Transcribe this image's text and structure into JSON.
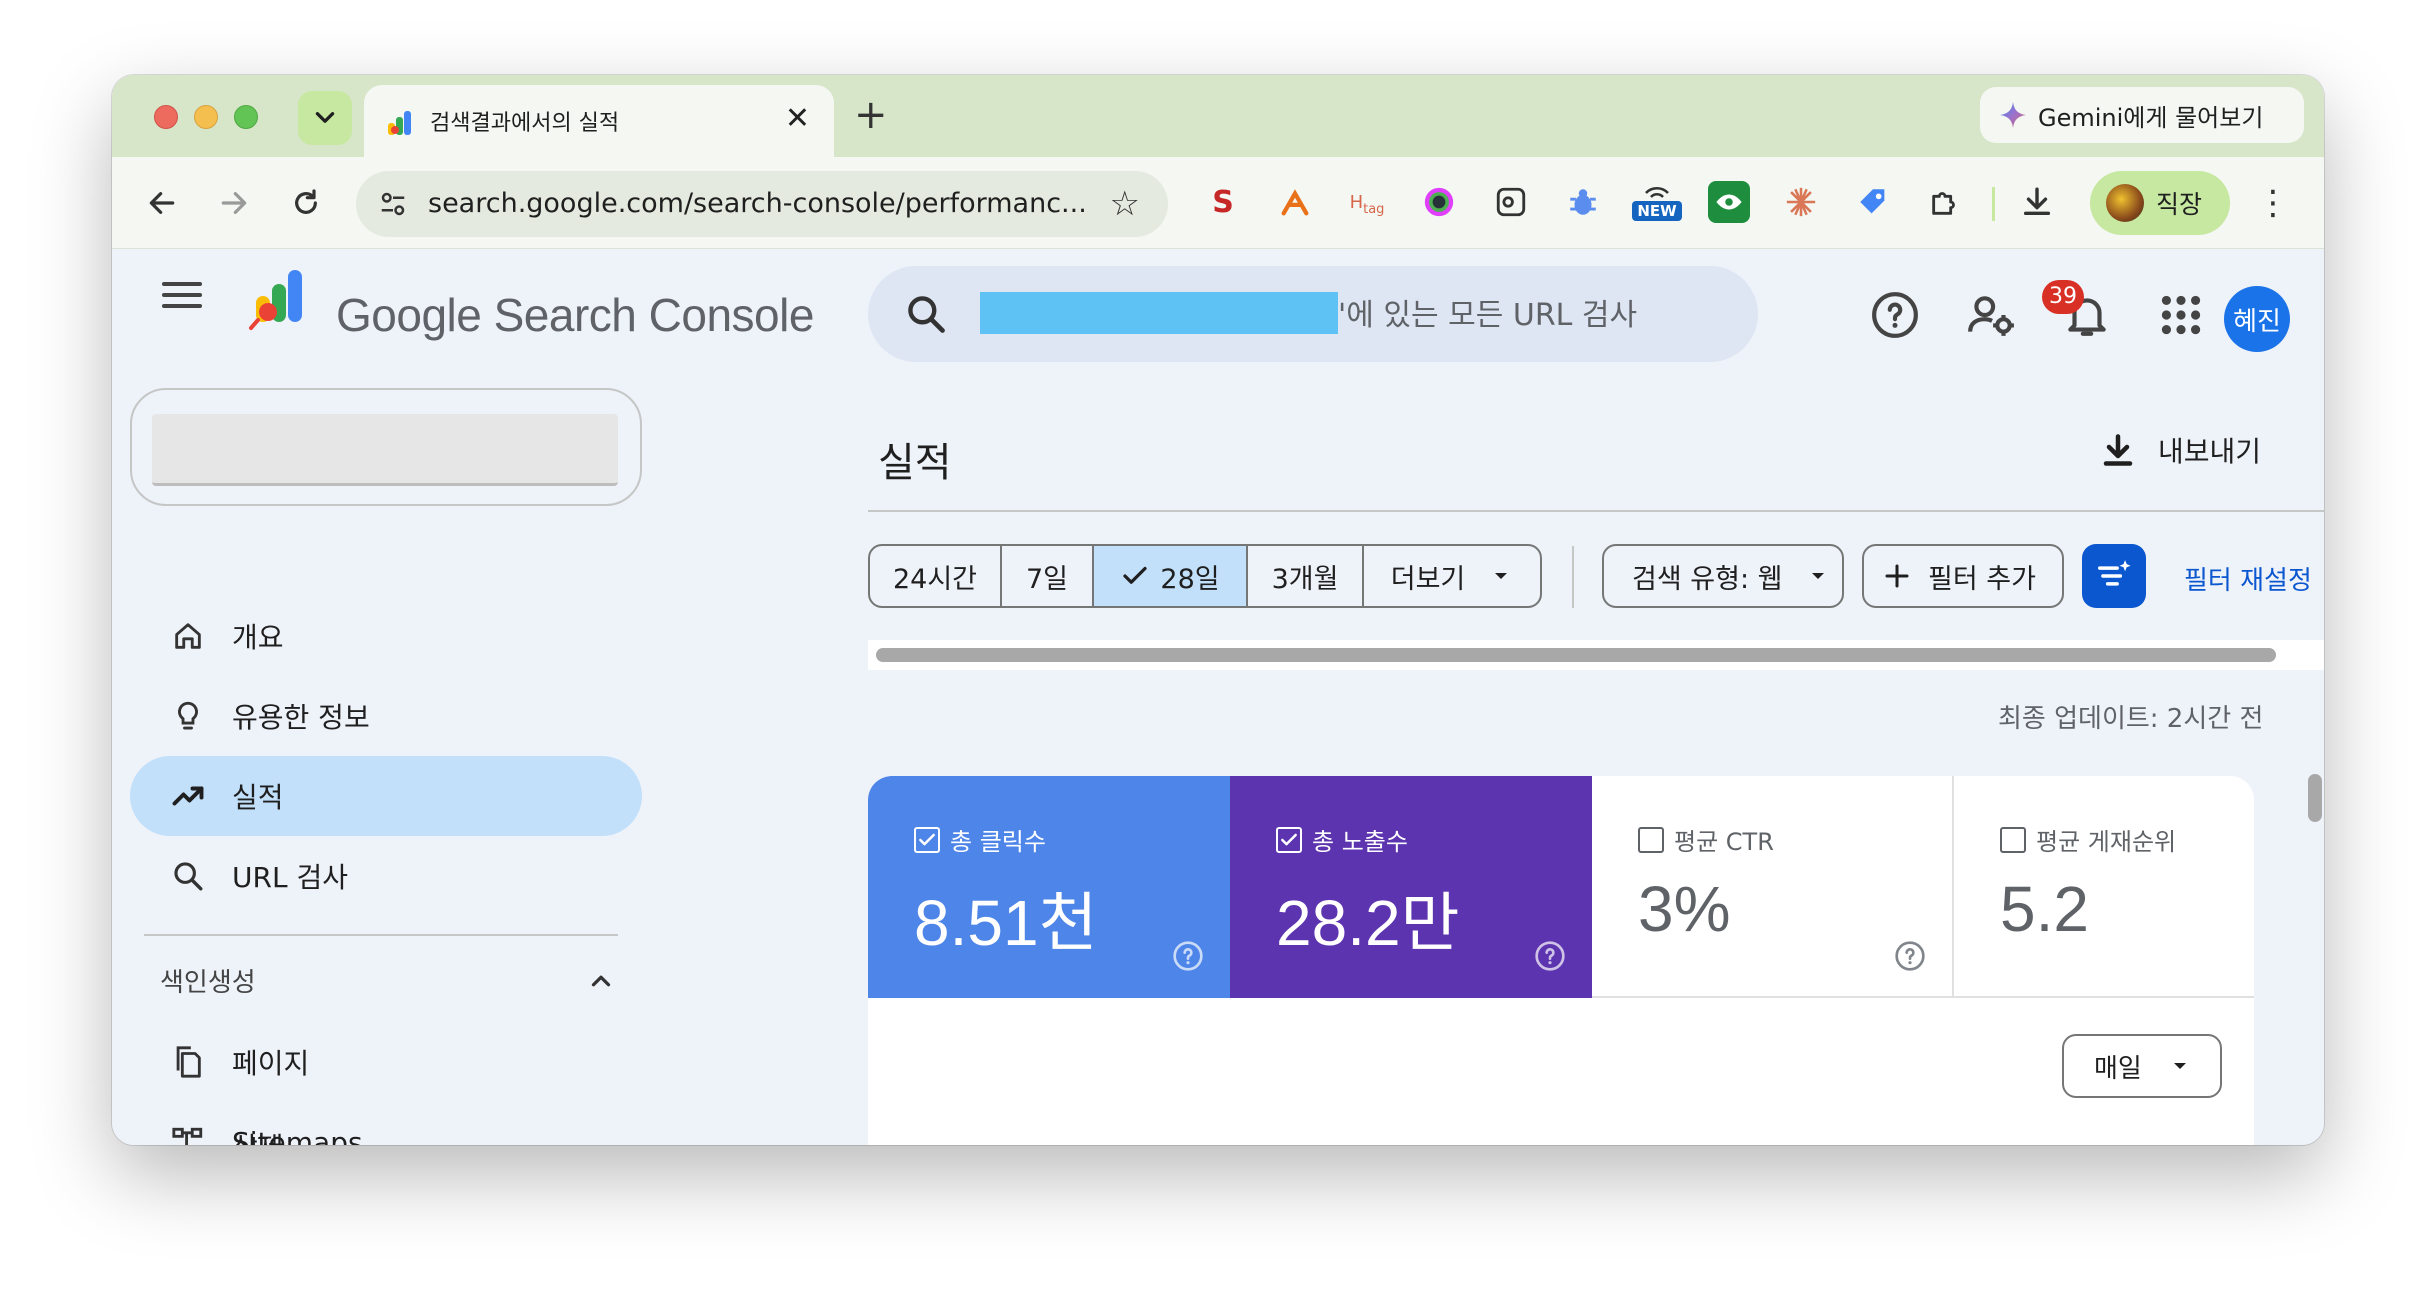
{
  "browser": {
    "tab_title": "검색결과에서의 실적",
    "new_tab": "+",
    "tab_close": "✕",
    "gemini_label": "Gemini에게 물어보기",
    "url": "search.google.com/search-console/performanc...",
    "profile_label": "직장",
    "extensions": [
      "seo-extension-icon",
      "tools-extension-icon",
      "htag-extension-icon",
      "color-picker-extension-icon",
      "screenshot-extension-icon",
      "bug-extension-icon",
      "new-extension-icon",
      "eye-extension-icon",
      "asterisk-extension-icon",
      "tag-extension-icon",
      "puzzle-extensions-icon"
    ],
    "new_badge": "NEW",
    "ext_h": "H",
    "ext_tag": "tag"
  },
  "header": {
    "brand": "Google Search Console",
    "search_placeholder": "'에 있는 모든 URL 검사",
    "notification_count": "39",
    "user_initials": "혜진"
  },
  "sidebar": {
    "items": [
      {
        "label": "개요",
        "icon": "home-icon"
      },
      {
        "label": "유용한 정보",
        "icon": "lightbulb-icon"
      },
      {
        "label": "실적",
        "icon": "trending-up-icon",
        "active": true
      },
      {
        "label": "URL 검사",
        "icon": "search-icon"
      }
    ],
    "section_title": "색인생성",
    "sub_items": [
      {
        "label": "페이지",
        "icon": "pages-icon"
      },
      {
        "label": "Sitemaps",
        "icon": "sitemap-icon"
      }
    ],
    "cut_item": "삭제"
  },
  "main": {
    "title": "실적",
    "export_label": "내보내기",
    "date_ranges": [
      "24시간",
      "7일",
      "28일",
      "3개월",
      "더보기"
    ],
    "selected_range": "28일",
    "search_type_chip": "검색 유형: 웹",
    "add_filter": "필터 추가",
    "reset_filters": "필터 재설정",
    "last_updated": "최종 업데이트: 2시간 전",
    "metrics": [
      {
        "label": "총 클릭수",
        "value": "8.51천",
        "checked": true,
        "color": "#4e85e8"
      },
      {
        "label": "총 노출수",
        "value": "28.2만",
        "checked": true,
        "color": "#5d34b0"
      },
      {
        "label": "평균 CTR",
        "value": "3%",
        "checked": false
      },
      {
        "label": "평균 게재순위",
        "value": "5.2",
        "checked": false
      }
    ],
    "granularity": "매일"
  },
  "colors": {
    "accent": "#0b57d0",
    "active_nav": "#c2e0fa",
    "tab_strip": "#d7e5c8",
    "page_bg": "#eef2f9"
  }
}
